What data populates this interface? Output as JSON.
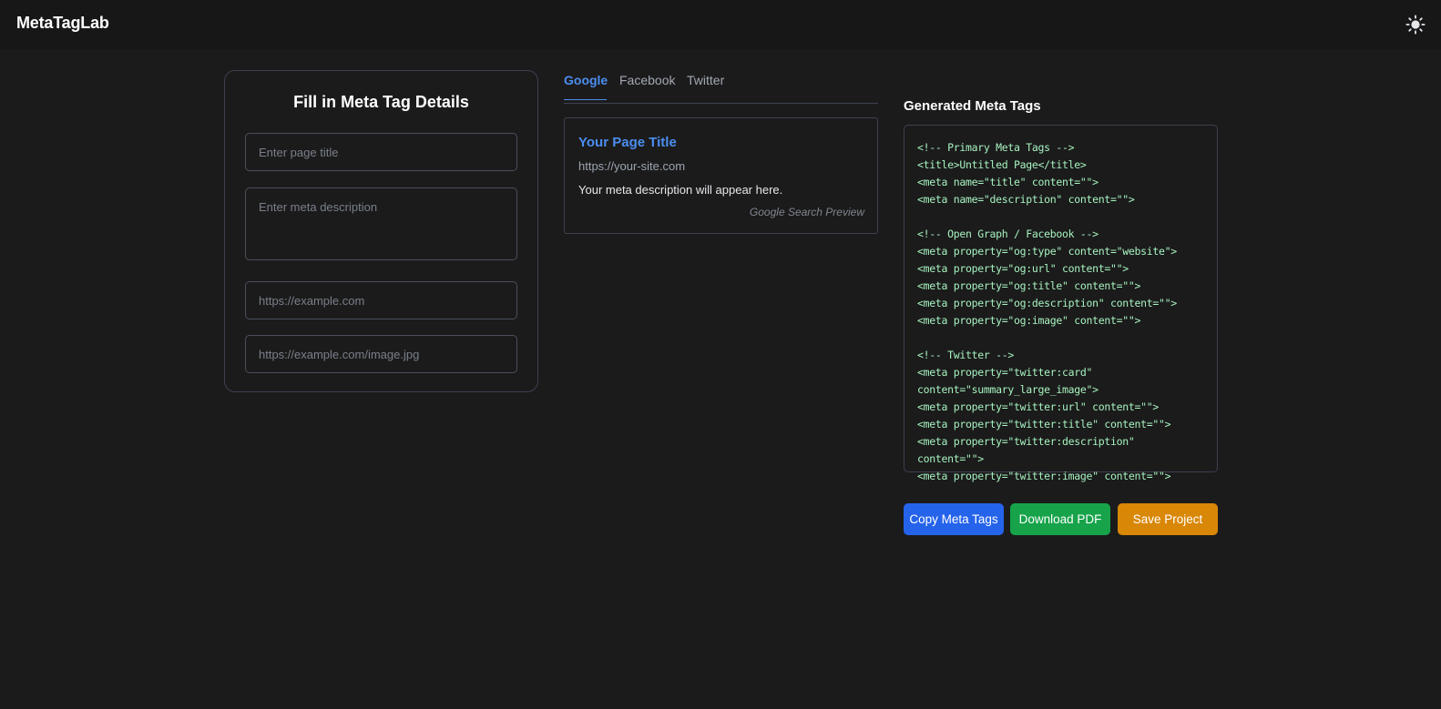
{
  "app": {
    "title": "MetaTagLab"
  },
  "form": {
    "heading": "Fill in Meta Tag Details",
    "title_placeholder": "Enter page title",
    "description_placeholder": "Enter meta description",
    "url_placeholder": "https://example.com",
    "image_placeholder": "https://example.com/image.jpg"
  },
  "tabs": [
    {
      "label": "Google",
      "active": true
    },
    {
      "label": "Facebook",
      "active": false
    },
    {
      "label": "Twitter",
      "active": false
    }
  ],
  "preview": {
    "title": "Your Page Title",
    "url": "https://your-site.com",
    "description": "Your meta description will appear here.",
    "caption": "Google Search Preview"
  },
  "generated": {
    "heading": "Generated Meta Tags",
    "lines": [
      "<!-- Primary Meta Tags -->",
      "<title>Untitled Page</title>",
      "<meta name=\"title\" content=\"\">",
      "<meta name=\"description\" content=\"\">",
      "",
      "<!-- Open Graph / Facebook -->",
      "<meta property=\"og:type\" content=\"website\">",
      "<meta property=\"og:url\" content=\"\">",
      "<meta property=\"og:title\" content=\"\">",
      "<meta property=\"og:description\" content=\"\">",
      "<meta property=\"og:image\" content=\"\">",
      "",
      "<!-- Twitter -->",
      "<meta property=\"twitter:card\"",
      "content=\"summary_large_image\">",
      "<meta property=\"twitter:url\" content=\"\">",
      "<meta property=\"twitter:title\" content=\"\">",
      "<meta property=\"twitter:description\"",
      "content=\"\">",
      "<meta property=\"twitter:image\" content=\"\">"
    ]
  },
  "buttons": {
    "copy": "Copy Meta Tags",
    "download": "Download PDF",
    "save": "Save Project"
  },
  "colors": {
    "accent": "#4b8ef0",
    "copy": "#2563eb",
    "download": "#16a34a",
    "save": "#d98706",
    "code": "#a7f3c0"
  },
  "icons": {
    "theme": "sun-icon"
  }
}
